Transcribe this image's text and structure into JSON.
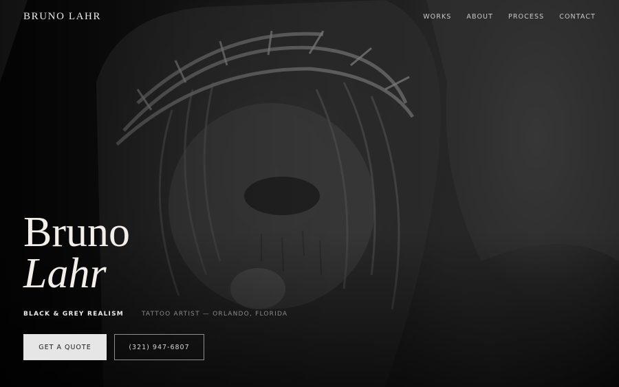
{
  "header": {
    "brand": "BRUNO LAHR",
    "nav": [
      "WORKS",
      "ABOUT",
      "PROCESS",
      "CONTACT"
    ]
  },
  "hero": {
    "title_line1": "Bruno",
    "title_line2": "Lahr",
    "specialty": "BLACK & GREY REALISM",
    "location": "TATTOO ARTIST — ORLANDO, FLORIDA",
    "image_subject": "black and grey realism tattoo of Christ with crown of thorns"
  },
  "actions": {
    "quote_label": "GET A QUOTE",
    "phone_label": "(321) 947-6807"
  },
  "colors": {
    "background": "#0b0b0c",
    "primary_button": "#e6e6e6",
    "text": "#e8e6e3"
  }
}
